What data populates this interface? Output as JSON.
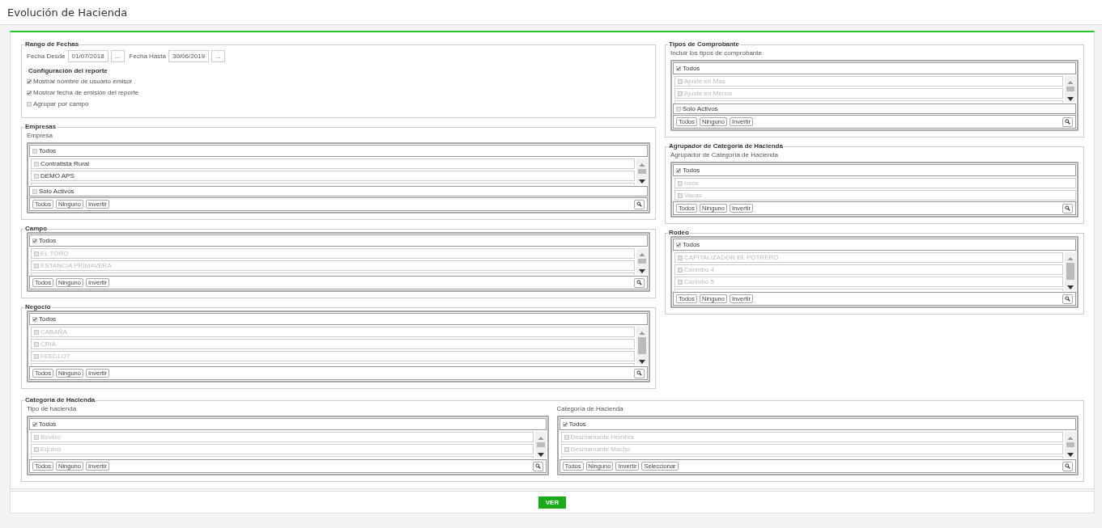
{
  "title": "Evolución de Hacienda",
  "left": [
    {
      "kind": "dates",
      "legend": "Rango de Fechas",
      "fields": [
        {
          "label": "Fecha Desde",
          "value": "01/07/2018",
          "button": "..."
        },
        {
          "label": "Fecha Hasta",
          "value": "30/06/2019",
          "button": "..."
        }
      ],
      "subheading": "Configuración del reporte",
      "options": [
        {
          "label": "Mostrar nombre de usuario emisor",
          "checked": true
        },
        {
          "label": "Mostrar fecha de emisión del reporte",
          "checked": true
        },
        {
          "label": "Agrupar por campo",
          "checked": false
        }
      ]
    },
    {
      "kind": "select",
      "legend": "Empresas",
      "pickers": [
        {
          "label": "Empresa",
          "all": {
            "label": "Todos",
            "checked": false
          },
          "items": [
            {
              "label": "Contratista Rural",
              "checked": false,
              "disabled": false
            },
            {
              "label": "DEMO APS",
              "checked": false,
              "disabled": false
            }
          ],
          "scrollbar": true,
          "filter": {
            "label": "Solo Activos",
            "checked": false
          },
          "actions": [
            "Todos",
            "Ninguno",
            "Invertir"
          ]
        }
      ]
    },
    {
      "kind": "select",
      "legend": "Campo",
      "pickers": [
        {
          "all": {
            "label": "Todos",
            "checked": true
          },
          "items": [
            {
              "label": "EL TORO",
              "checked": false,
              "disabled": true
            },
            {
              "label": "ESTANCIA PRIMAVERA",
              "checked": false,
              "disabled": true
            }
          ],
          "scrollbar": true,
          "actions": [
            "Todos",
            "Ninguno",
            "Invertir"
          ]
        }
      ]
    },
    {
      "kind": "select",
      "legend": "Negocio",
      "pickers": [
        {
          "all": {
            "label": "Todos",
            "checked": true
          },
          "items": [
            {
              "label": "CABAÑA",
              "checked": false,
              "disabled": true
            },
            {
              "label": "CRIA",
              "checked": false,
              "disabled": true
            },
            {
              "label": "FEEDLOT",
              "checked": false,
              "disabled": true
            }
          ],
          "scrollbar": true,
          "actions": [
            "Todos",
            "Ninguno",
            "Invertir"
          ]
        }
      ]
    }
  ],
  "right": [
    {
      "kind": "select",
      "legend": "Tipos de Comprobante",
      "pickers": [
        {
          "label": "Incluir los tipos de comprobante",
          "all": {
            "label": "Todos",
            "checked": true
          },
          "items": [
            {
              "label": "Ajuste en Mas",
              "checked": false,
              "disabled": true
            },
            {
              "label": "Ajuste en Menos",
              "checked": false,
              "disabled": true
            }
          ],
          "scrollbar": true,
          "filter": {
            "label": "Solo Activos",
            "checked": false
          },
          "actions": [
            "Todos",
            "Ninguno",
            "Invertir"
          ]
        }
      ]
    },
    {
      "kind": "select",
      "legend": "Agrupador de Categoría de Hacienda",
      "pickers": [
        {
          "label": "Agrupador de Categoría de Hacienda",
          "all": {
            "label": "Todos",
            "checked": true
          },
          "items": [
            {
              "label": "toros",
              "checked": false,
              "disabled": true
            },
            {
              "label": "Vacas",
              "checked": false,
              "disabled": true
            }
          ],
          "scrollbar": false,
          "actions": [
            "Todos",
            "Ninguno",
            "Invertir"
          ]
        }
      ]
    },
    {
      "kind": "select",
      "legend": "Rodeo",
      "pickers": [
        {
          "all": {
            "label": "Todos",
            "checked": true
          },
          "items": [
            {
              "label": "CAPITALIZADOR EL POTRERO",
              "checked": false,
              "disabled": true
            },
            {
              "label": "Carimbo 4",
              "checked": false,
              "disabled": true
            },
            {
              "label": "Carimbo 5",
              "checked": false,
              "disabled": true
            }
          ],
          "scrollbar": true,
          "actions": [
            "Todos",
            "Ninguno",
            "Invertir"
          ]
        }
      ]
    }
  ],
  "bottom": {
    "kind": "select",
    "legend": "Categoría de Hacienda",
    "pickers": [
      {
        "label": "Tipo de hacienda",
        "all": {
          "label": "Todos",
          "checked": true
        },
        "items": [
          {
            "label": "Bovino",
            "checked": false,
            "disabled": true
          },
          {
            "label": "Equino",
            "checked": false,
            "disabled": true
          }
        ],
        "scrollbar": true,
        "actions": [
          "Todos",
          "Ninguno",
          "Invertir"
        ]
      },
      {
        "label": "Categoría de Hacienda",
        "all": {
          "label": "Todos",
          "checked": true
        },
        "items": [
          {
            "label": "Desmamante Hembra",
            "checked": false,
            "disabled": true
          },
          {
            "label": "Desmamante Macho",
            "checked": false,
            "disabled": true
          }
        ],
        "scrollbar": true,
        "actions": [
          "Todos",
          "Ninguno",
          "Invertir",
          "Seleccionar"
        ]
      }
    ]
  },
  "submit": "VER"
}
